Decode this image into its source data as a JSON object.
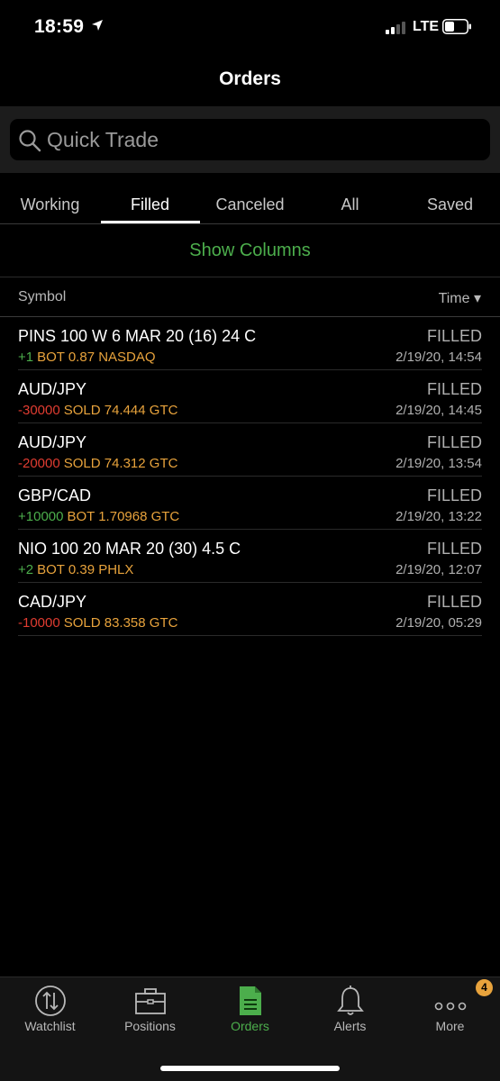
{
  "status_bar": {
    "time": "18:59",
    "carrier": "LTE"
  },
  "header": {
    "title": "Orders"
  },
  "search": {
    "placeholder": "Quick Trade"
  },
  "tabs": [
    {
      "label": "Working"
    },
    {
      "label": "Filled",
      "active": true
    },
    {
      "label": "Canceled"
    },
    {
      "label": "All"
    },
    {
      "label": "Saved"
    }
  ],
  "show_columns": "Show Columns",
  "columns": {
    "symbol": "Symbol",
    "time": "Time ▾"
  },
  "orders": [
    {
      "symbol": "PINS 100 W 6 MAR 20 (16) 24 C",
      "qty": "+1",
      "info": "BOT 0.87 NASDAQ",
      "status": "FILLED",
      "time": "2/19/20, 14:54"
    },
    {
      "symbol": "AUD/JPY",
      "qty": "-30000",
      "info": "SOLD 74.444 GTC",
      "status": "FILLED",
      "time": "2/19/20, 14:45"
    },
    {
      "symbol": "AUD/JPY",
      "qty": "-20000",
      "info": "SOLD 74.312 GTC",
      "status": "FILLED",
      "time": "2/19/20, 13:54"
    },
    {
      "symbol": "GBP/CAD",
      "qty": "+10000",
      "info": "BOT 1.70968 GTC",
      "status": "FILLED",
      "time": "2/19/20, 13:22"
    },
    {
      "symbol": "NIO 100 20 MAR 20 (30) 4.5 C",
      "qty": "+2",
      "info": "BOT 0.39 PHLX",
      "status": "FILLED",
      "time": "2/19/20, 12:07"
    },
    {
      "symbol": "CAD/JPY",
      "qty": "-10000",
      "info": "SOLD 83.358 GTC",
      "status": "FILLED",
      "time": "2/19/20, 05:29"
    }
  ],
  "tabbar": [
    {
      "label": "Watchlist",
      "icon": "watchlist-icon"
    },
    {
      "label": "Positions",
      "icon": "briefcase-icon"
    },
    {
      "label": "Orders",
      "icon": "document-icon",
      "active": true
    },
    {
      "label": "Alerts",
      "icon": "bell-icon"
    },
    {
      "label": "More",
      "icon": "more-dots-icon"
    }
  ],
  "more_badge": "4",
  "colors": {
    "accent": "#4cae4c",
    "sell": "#e03c31",
    "info": "#e8a33c",
    "badge": "#e8a33c"
  }
}
